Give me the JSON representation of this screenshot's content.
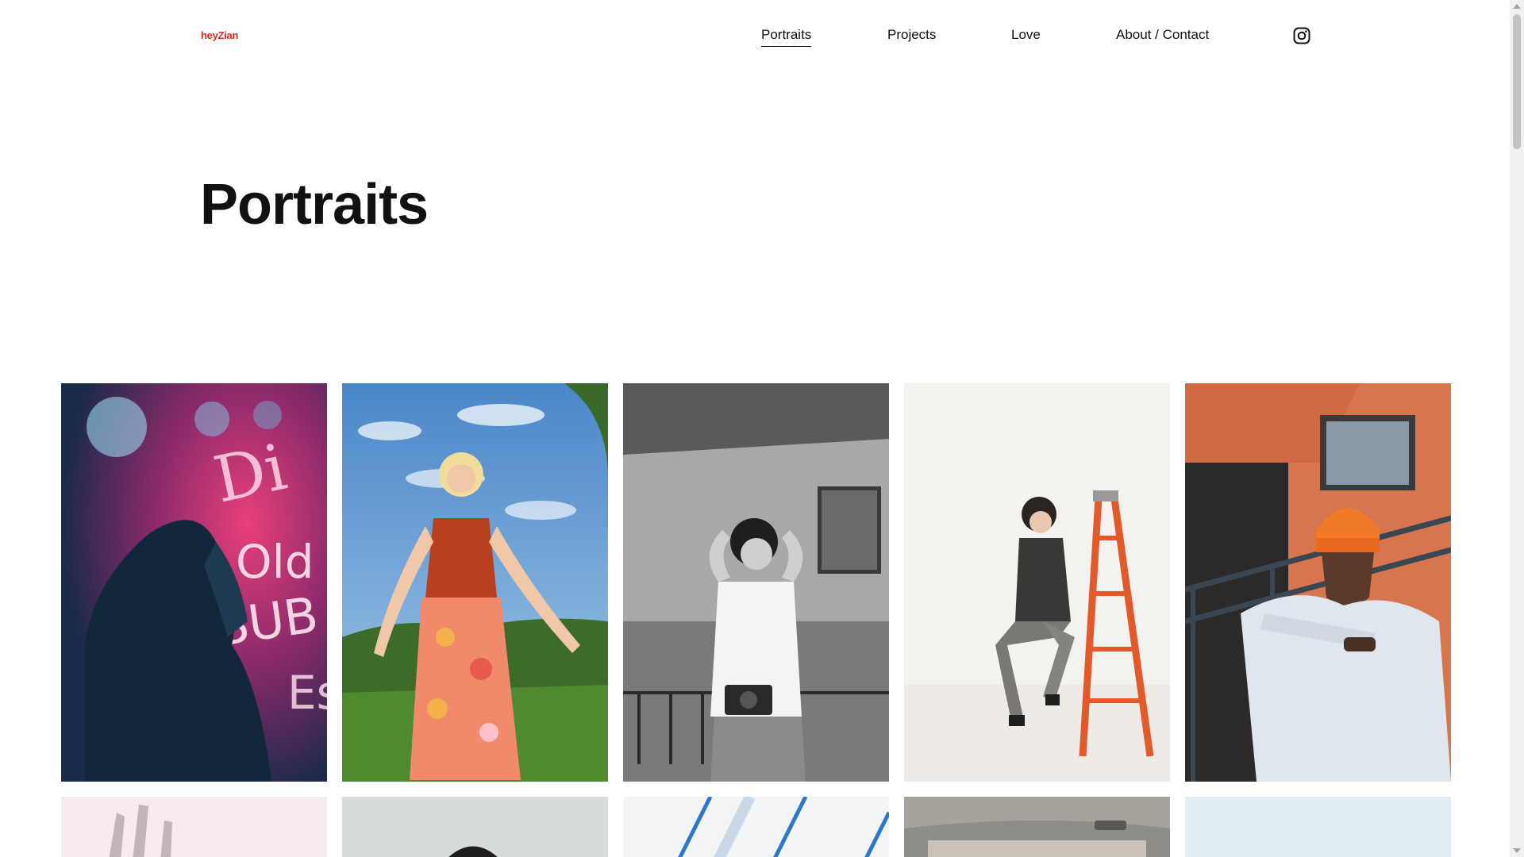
{
  "header": {
    "logo": "heyZian",
    "nav": [
      {
        "label": "Portraits",
        "active": true
      },
      {
        "label": "Projects",
        "active": false
      },
      {
        "label": "Love",
        "active": false
      },
      {
        "label": "About / Contact",
        "active": false
      }
    ],
    "social_icon": "instagram-icon"
  },
  "main": {
    "title": "Portraits",
    "gallery": [
      {
        "subject": "woman in profile beside pink neon sign"
      },
      {
        "subject": "blonde woman in red top and floral skirt under blue sky"
      },
      {
        "subject": "black and white portrait of woman with camera on stairwell"
      },
      {
        "subject": "woman in leather jacket sitting on orange ladder"
      },
      {
        "subject": "man in orange beanie leaning on railing by brick building"
      },
      {
        "subject": "blurred hand against pale background"
      },
      {
        "subject": "person with dark hair against grey wall"
      },
      {
        "subject": "white ceiling with blue stripes"
      },
      {
        "subject": "car interior roof"
      },
      {
        "subject": "pale blue sky"
      }
    ]
  },
  "colors": {
    "brand": "#d9281e",
    "text": "#111111",
    "background": "#ffffff"
  }
}
